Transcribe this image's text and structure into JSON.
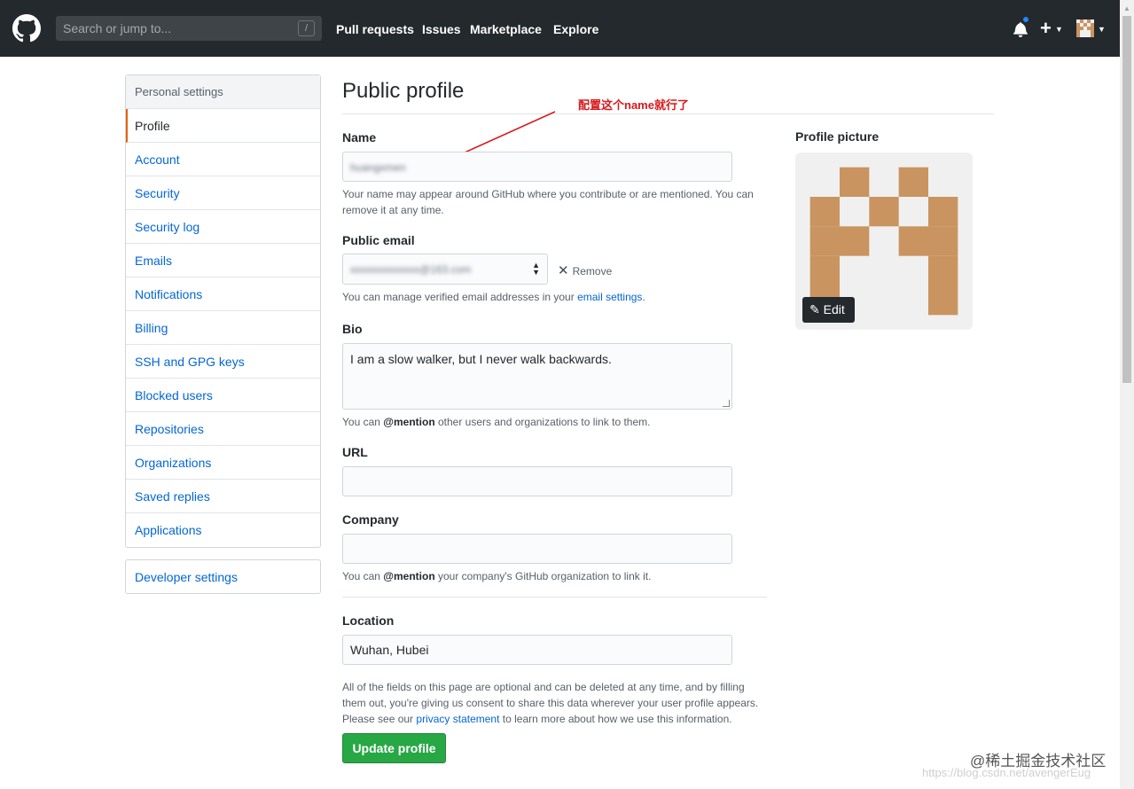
{
  "header": {
    "search_placeholder": "Search or jump to...",
    "search_shortcut": "/",
    "nav": [
      "Pull requests",
      "Issues",
      "Marketplace",
      "Explore"
    ]
  },
  "sidebar": {
    "heading": "Personal settings",
    "items": [
      {
        "label": "Profile",
        "selected": true
      },
      {
        "label": "Account"
      },
      {
        "label": "Security"
      },
      {
        "label": "Security log"
      },
      {
        "label": "Emails"
      },
      {
        "label": "Notifications"
      },
      {
        "label": "Billing"
      },
      {
        "label": "SSH and GPG keys"
      },
      {
        "label": "Blocked users"
      },
      {
        "label": "Repositories"
      },
      {
        "label": "Organizations"
      },
      {
        "label": "Saved replies"
      },
      {
        "label": "Applications"
      }
    ],
    "developer_settings": "Developer settings"
  },
  "main": {
    "title": "Public profile",
    "annotation": "配置这个name就行了",
    "name": {
      "label": "Name",
      "value": "huangxmen",
      "note": "Your name may appear around GitHub where you contribute or are mentioned. You can remove it at any time."
    },
    "public_email": {
      "label": "Public email",
      "value": "xxxxxxxxxxxxx@163.com",
      "remove_label": "Remove",
      "note_prefix": "You can manage verified email addresses in your",
      "note_link": "email settings",
      "note_suffix": "."
    },
    "bio": {
      "label": "Bio",
      "value": "I am a slow walker, but I never walk backwards.",
      "note_prefix": "You can",
      "note_mention": "@mention",
      "note_suffix": "other users and organizations to link to them."
    },
    "url": {
      "label": "URL",
      "value": ""
    },
    "company": {
      "label": "Company",
      "value": "",
      "note_prefix": "You can",
      "note_mention": "@mention",
      "note_suffix": "your company's GitHub organization to link it."
    },
    "location": {
      "label": "Location",
      "value": "Wuhan, Hubei"
    },
    "footer_note_1": "All of the fields on this page are optional and can be deleted at any time, and by filling them out, you're giving us consent to share this data wherever your user profile appears. Please see our",
    "footer_link": "privacy statement",
    "footer_note_2": "to learn more about how we use this information.",
    "submit_label": "Update profile"
  },
  "profile_picture": {
    "label": "Profile picture",
    "edit_label": "Edit",
    "avatar_color": "#c99460"
  },
  "watermark": {
    "main": "@稀土掘金技术社区",
    "sub": "https://blog.csdn.net/avengerEug"
  }
}
